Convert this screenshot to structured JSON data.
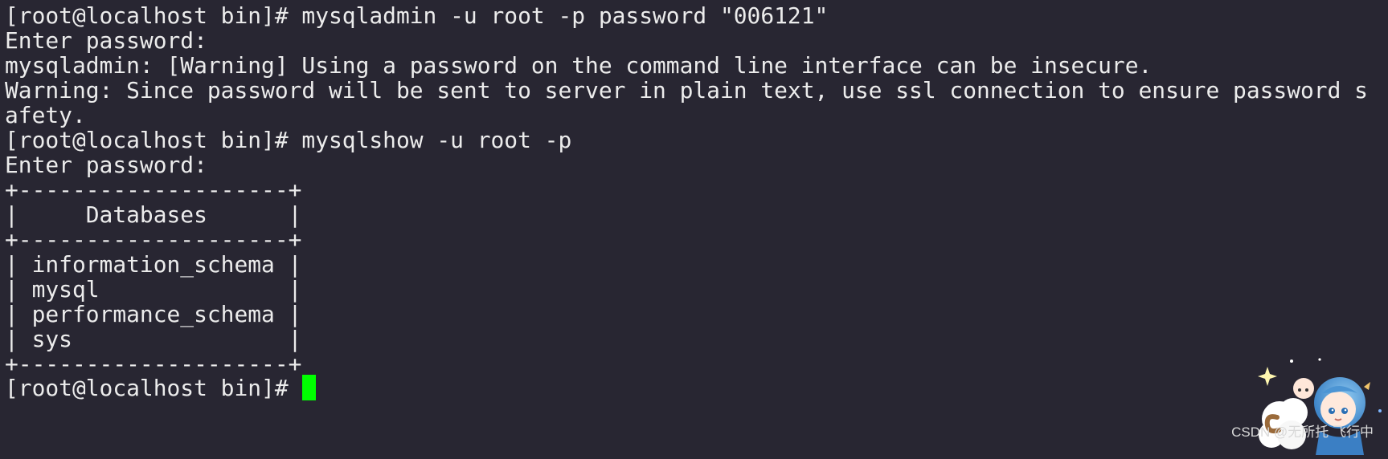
{
  "terminal": {
    "lines": [
      "[root@localhost bin]# mysqladmin -u root -p password \"006121\"",
      "Enter password:",
      "mysqladmin: [Warning] Using a password on the command line interface can be insecure.",
      "Warning: Since password will be sent to server in plain text, use ssl connection to ensure password s",
      "afety.",
      "[root@localhost bin]# mysqlshow -u root -p",
      "Enter password:",
      "+--------------------+",
      "|     Databases      |",
      "+--------------------+",
      "| information_schema |",
      "| mysql              |",
      "| performance_schema |",
      "| sys                |",
      "+--------------------+"
    ],
    "prompt": "[root@localhost bin]#",
    "cursor_color": "#00ff00",
    "background_color": "#282632",
    "text_color": "#ececec"
  },
  "watermark": {
    "text": "CSDN @无所托 飞行中"
  }
}
